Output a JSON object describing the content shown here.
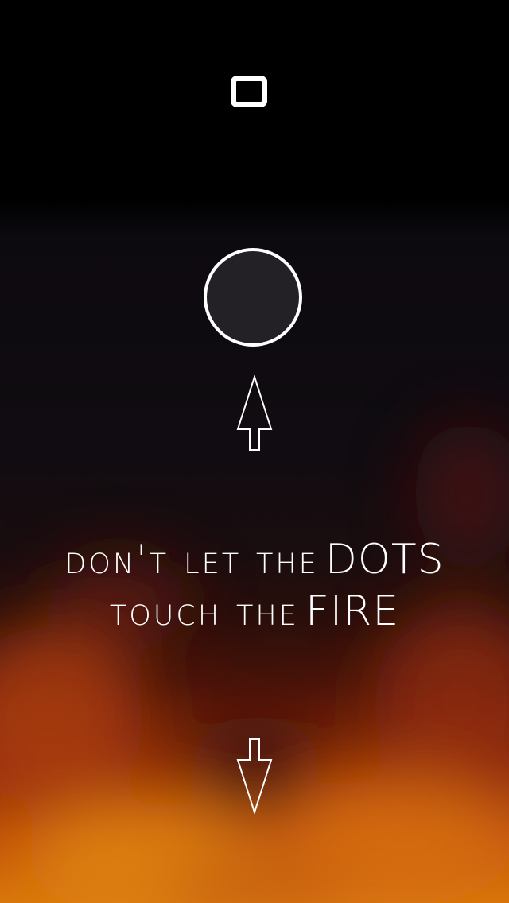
{
  "controls": {
    "pause_icon": "pause-square-icon"
  },
  "game": {
    "dot_color": "#232126",
    "instruction_line1_prefix": "don't let the",
    "instruction_line1_emphasis": "DOTS",
    "instruction_line2_prefix": "touch the",
    "instruction_line2_emphasis": "FIRE",
    "up_arrow_icon": "arrow-up-icon",
    "down_arrow_icon": "arrow-down-icon"
  },
  "colors": {
    "background_top": "#000000",
    "fire_orange": "#d9760c",
    "fire_red": "#8a2a08",
    "foreground": "#ffffff"
  }
}
